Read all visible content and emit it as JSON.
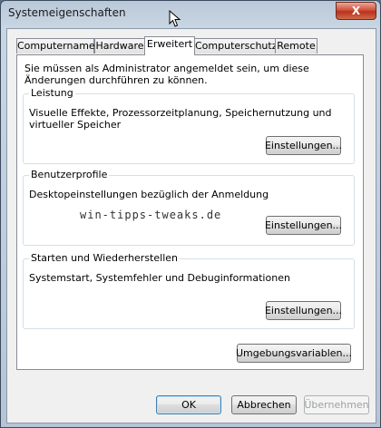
{
  "window": {
    "title": "Systemeigenschaften",
    "close_label": "X"
  },
  "tabs": [
    {
      "label": "Computername"
    },
    {
      "label": "Hardware"
    },
    {
      "label": "Erweitert"
    },
    {
      "label": "Computerschutz"
    },
    {
      "label": "Remote"
    }
  ],
  "active_tab": "Erweitert",
  "intro_text": "Sie müssen als Administrator angemeldet sein, um diese Änderungen durchführen zu können.",
  "groups": {
    "leistung": {
      "title": "Leistung",
      "description": "Visuelle Effekte, Prozessorzeitplanung, Speichernutzung und virtueller Speicher",
      "button": "Einstellungen..."
    },
    "benutzerprofile": {
      "title": "Benutzerprofile",
      "description": "Desktopeinstellungen bezüglich der Anmeldung",
      "watermark": "win-tipps-tweaks.de",
      "button": "Einstellungen..."
    },
    "starten": {
      "title": "Starten und Wiederherstellen",
      "description": "Systemstart, Systemfehler und Debuginformationen",
      "button": "Einstellungen..."
    }
  },
  "env_button": "Umgebungsvariablen...",
  "footer": {
    "ok": "OK",
    "cancel": "Abbrechen",
    "apply": "Übernehmen"
  },
  "colors": {
    "close_button": "#c9452f",
    "default_button_border": "#3c7fb1"
  }
}
